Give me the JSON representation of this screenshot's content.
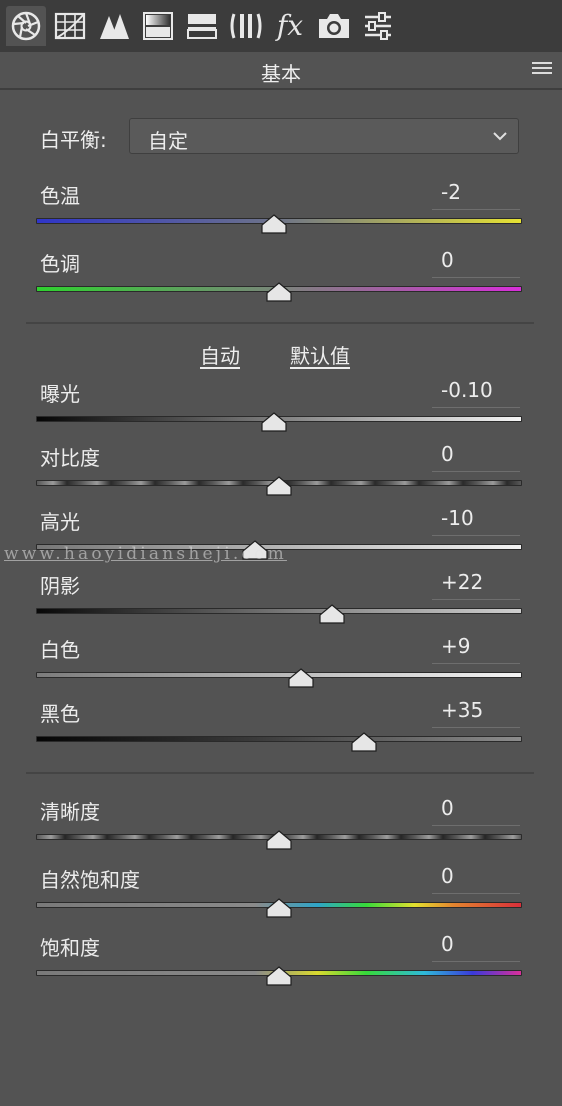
{
  "toolbar": {
    "tools": [
      {
        "icon": "aperture-icon",
        "active": true
      },
      {
        "icon": "tone-curve-grid-icon"
      },
      {
        "icon": "detail-triangles-icon"
      },
      {
        "icon": "hsl-gradient-icon"
      },
      {
        "icon": "split-toning-icon"
      },
      {
        "icon": "lens-correction-icon"
      },
      {
        "icon": "effects-fx-icon",
        "label": "fx"
      },
      {
        "icon": "camera-calibration-icon"
      },
      {
        "icon": "presets-sliders-icon"
      }
    ]
  },
  "panel": {
    "title": "基本",
    "menu_icon": "hamburger-menu-icon"
  },
  "white_balance": {
    "label": "白平衡:",
    "value": "自定"
  },
  "sliders": {
    "temp": {
      "label": "色温",
      "value": "-2",
      "position": 0.49
    },
    "tint": {
      "label": "色调",
      "value": "0",
      "position": 0.5
    },
    "exposure": {
      "label": "曝光",
      "value": "-0.10",
      "position": 0.49
    },
    "contrast": {
      "label": "对比度",
      "value": "0",
      "position": 0.5
    },
    "highlights": {
      "label": "高光",
      "value": "-10",
      "position": 0.45
    },
    "shadows": {
      "label": "阴影",
      "value": "+22",
      "position": 0.61
    },
    "whites": {
      "label": "白色",
      "value": "+9",
      "position": 0.545
    },
    "blacks": {
      "label": "黑色",
      "value": "+35",
      "position": 0.675
    },
    "clarity": {
      "label": "清晰度",
      "value": "0",
      "position": 0.5
    },
    "vibrance": {
      "label": "自然饱和度",
      "value": "0",
      "position": 0.5
    },
    "saturation": {
      "label": "饱和度",
      "value": "0",
      "position": 0.5
    }
  },
  "actions": {
    "auto": "自动",
    "default": "默认值"
  },
  "watermark": "www.haoyidiansheji.com",
  "colors": {
    "panel_bg": "#535353",
    "toolbar_bg": "#3c3c3c",
    "text": "#e6e6e6"
  }
}
